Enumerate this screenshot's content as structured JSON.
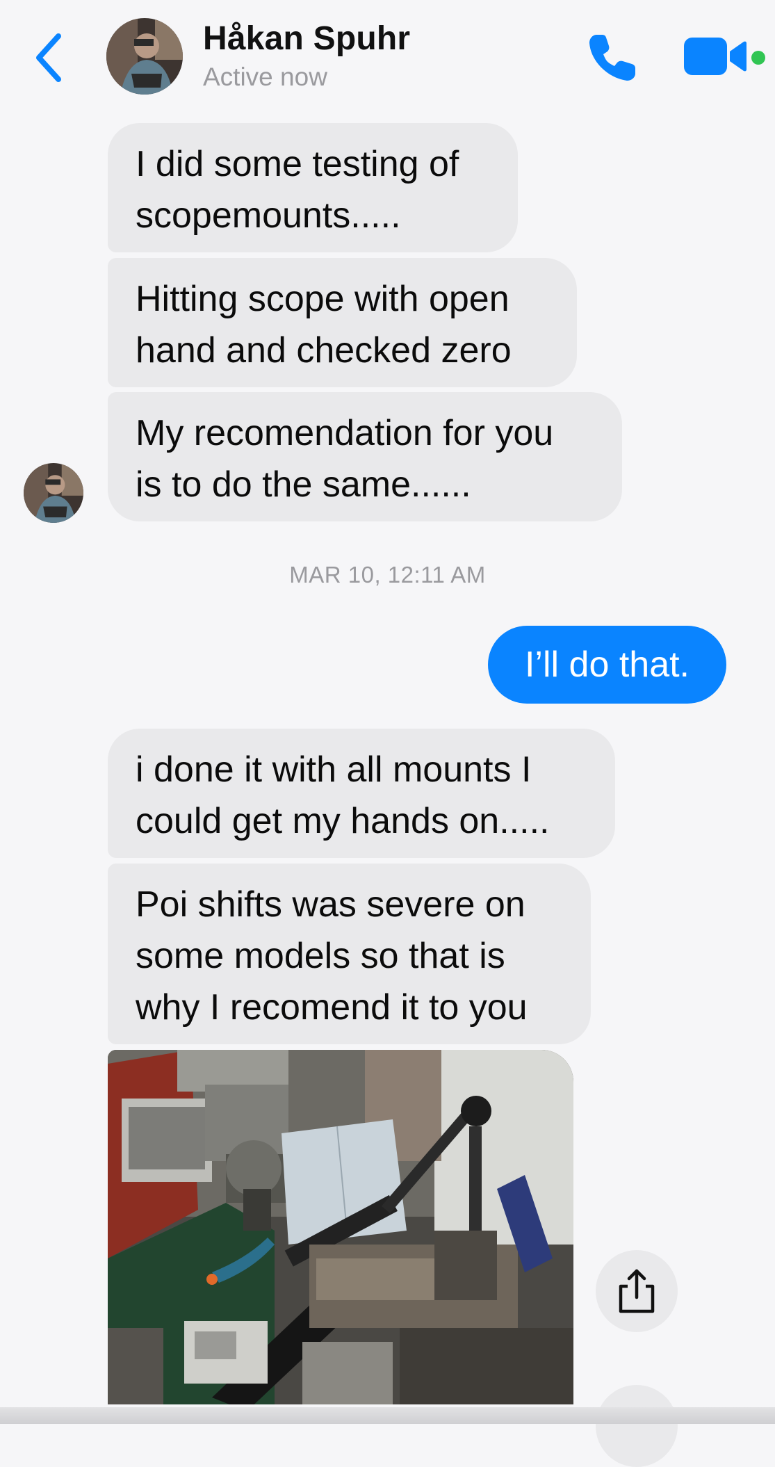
{
  "header": {
    "contact_name": "Håkan Spuhr",
    "status": "Active now",
    "back_icon": "chevron-left-icon",
    "call_icon": "phone-icon",
    "video_icon": "video-camera-icon",
    "accent_color": "#0a84ff",
    "active_color": "#31c553"
  },
  "messages": [
    {
      "sender": "contact",
      "text": "I did some testing of\nscopemounts....."
    },
    {
      "sender": "contact",
      "text": "Hitting scope with open\nhand and checked zero"
    },
    {
      "sender": "contact",
      "text": "My recomendation for you\nis to do the same......"
    },
    {
      "type": "timestamp",
      "text": "MAR 10, 12:11 AM"
    },
    {
      "sender": "me",
      "text": "I’ll do that."
    },
    {
      "sender": "contact",
      "text": "i done it with all mounts I\ncould get my hands on....."
    },
    {
      "sender": "contact",
      "text": "Poi shifts was severe on\nsome models so that is\nwhy I recomend it to you"
    },
    {
      "sender": "contact",
      "type": "photo"
    }
  ],
  "share_icon": "share-icon",
  "colors": {
    "incoming_bubble": "#e9e9eb",
    "outgoing_bubble": "#0a84ff",
    "background": "#f6f6f8"
  }
}
